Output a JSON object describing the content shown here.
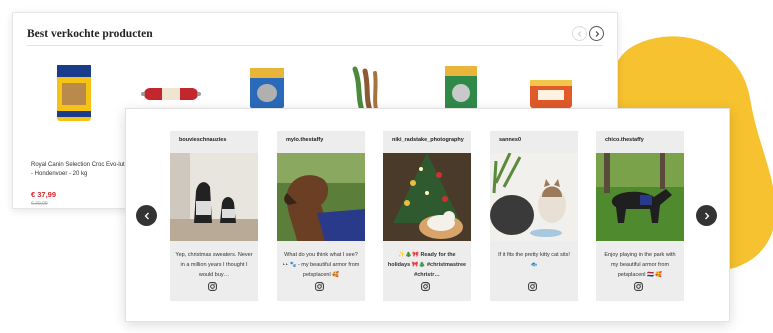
{
  "colors": {
    "accent_yellow": "#f6c22f",
    "price_red": "#d8262d",
    "dark": "#333333"
  },
  "best_sellers": {
    "title": "Best verkochte producten",
    "prev_icon": "chevron-left-icon",
    "next_icon": "chevron-right-icon",
    "product": {
      "name": "Royal Canin Selection Croc Evo-lution - Hondenvoer - 20 kg",
      "price": "€ 37,99",
      "old_price": "€ 39,99"
    },
    "product_images": [
      "dog-food-bag-icon",
      "sausage-snack-icon",
      "blinkas-cat-litter-icon",
      "chew-sticks-icon",
      "blinkas-litter-bag-icon",
      "cat-food-tin-icon"
    ]
  },
  "instagram": {
    "prev_icon": "chevron-left-icon",
    "next_icon": "chevron-right-icon",
    "posts": [
      {
        "user": "bouvieschnauzies",
        "caption": "Yep, christmas sweaters. Never in a million years I thought I would buy…",
        "icon": "instagram-icon"
      },
      {
        "user": "mylo.thestaffy",
        "caption": "What do you think what I see?👀🐾 - my beautiful armor from petsplacenl 🥰",
        "icon": "instagram-icon"
      },
      {
        "user": "niki_radstake_photography",
        "caption": "✨🎄🎀 Ready for the holidays 🎀🎄 #christmastree #christr…",
        "icon": "instagram-icon"
      },
      {
        "user": "sannes0",
        "caption": "If it fits the pretty kitty cat sits! 🐟",
        "icon": "instagram-icon"
      },
      {
        "user": "chico.thestaffy",
        "caption": "Enjoy playing in the park with my beautiful armor from petsplacenl 🇳🇱 🥰",
        "icon": "instagram-icon"
      }
    ]
  }
}
